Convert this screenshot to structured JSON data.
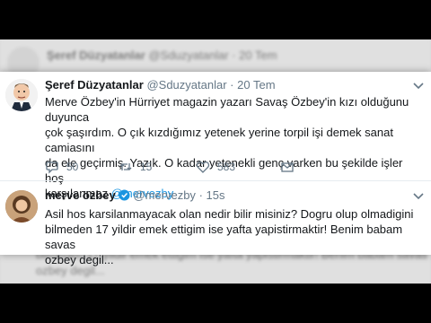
{
  "background_tweet": {
    "name": "Şeref Düzyatanlar",
    "handle": "@Sduzyatanlar",
    "separator": "·",
    "time": "20 Tem",
    "bottom_line_1": "bilmeden 17 yildir emek ettigim ise yafta yapistirmaktir! Benim babam savas",
    "bottom_line_2": "ozbey degil..."
  },
  "tweet1": {
    "name": "Şeref Düzyatanlar",
    "handle": "@Sduzyatanlar",
    "separator": "·",
    "time": "20 Tem",
    "text_lines": [
      "Merve Özbey'in Hürriyet magazin yazarı Savaş Özbey'in kızı olduğunu duyunca",
      "çok şaşırdım. O çık kızdığımız yetenek yerine torpil işi demek sanat camiasını",
      "da ele geçirmiş. Yazık. O kadar yetenekli genç varken bu şekilde işler hoş"
    ],
    "last_line_text": "karşılanmaz ",
    "mention": "@mervezby",
    "replies": "50",
    "retweets": "15",
    "likes": "583"
  },
  "tweet2": {
    "name": "merve özbey",
    "handle": "@mervezby",
    "separator": "·",
    "time": "15s",
    "text_lines": [
      "Asil hos karsilanmayacak olan nedir bilir misiniz? Dogru olup olmadigini",
      "bilmeden 17 yildir emek ettigim ise yafta yapistirmaktir! Benim babam savas",
      "ozbey degil..."
    ]
  },
  "colors": {
    "accent": "#1b95e0",
    "text": "#14171a",
    "muted": "#657786"
  }
}
